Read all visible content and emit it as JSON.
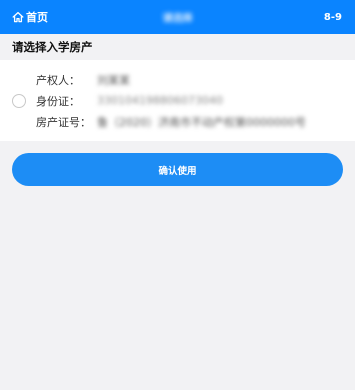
{
  "header": {
    "home_label": "首页",
    "title": "请选择",
    "right_text": "8-9",
    "bg_color": "#0a84ff"
  },
  "section": {
    "title": "请选择入学房产"
  },
  "property": {
    "owner_label": "产权人：",
    "owner_value": "刘某某",
    "id_label": "身份证：",
    "id_value": "330104198806073040",
    "cert_label": "房产证号：",
    "cert_value": "鲁（2020）济南市不动产权第0000000号"
  },
  "confirm_button": {
    "label": "确认使用",
    "color": "#1d8df5"
  }
}
